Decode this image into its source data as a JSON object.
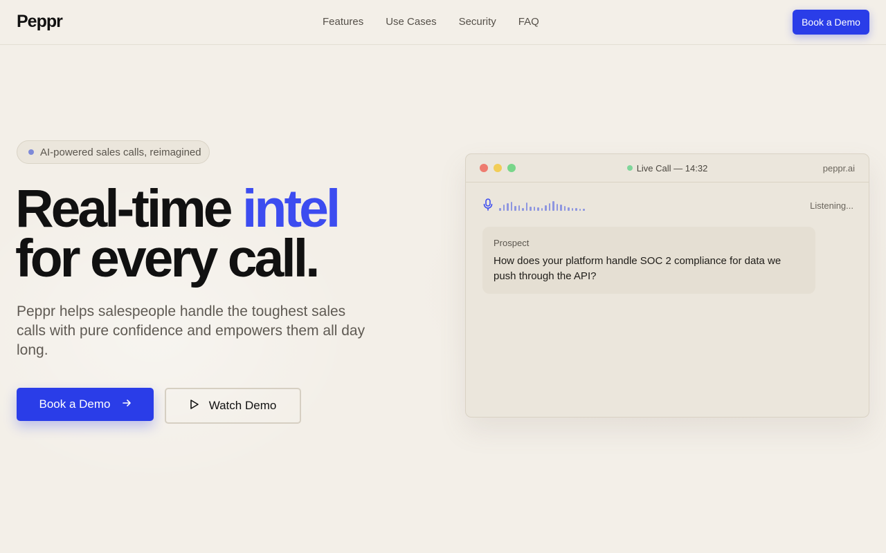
{
  "nav": {
    "logo": "Peppr",
    "links": [
      "Features",
      "Use Cases",
      "Security",
      "FAQ"
    ],
    "cta": "Book a Demo"
  },
  "hero": {
    "badge": "AI-powered sales calls, reimagined",
    "headline_part1": "Real-time",
    "headline_accent": "intel",
    "headline_part2": "for every call.",
    "subtext": "Peppr helps salespeople handle the toughest sales calls with pure confidence and empowers them all day long.",
    "primary_button": "Book a Demo",
    "secondary_button": "Watch Demo"
  },
  "call_window": {
    "status": "Live Call — 14:32",
    "domain": "peppr.ai",
    "listening": "Listening...",
    "message": {
      "speaker": "Prospect",
      "text": "How does your platform handle SOC 2 compliance for data we push through the API?"
    }
  },
  "colors": {
    "accent": "#2a3de8",
    "accent_text": "#3c4cf0",
    "background": "#f3efe8",
    "live_dot": "#7fd69a"
  },
  "icons": {
    "arrow": "arrow-right-icon",
    "play": "play-icon",
    "mic": "microphone-icon"
  }
}
